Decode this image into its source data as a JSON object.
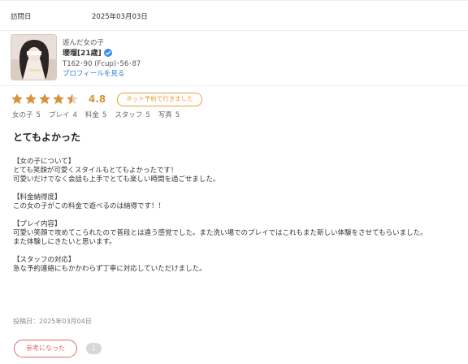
{
  "visit": {
    "label": "訪問日",
    "date": "2025年03月03日"
  },
  "profile": {
    "caption": "遊んだ女の子",
    "name": "瓔瑠[21歳]",
    "spec": "T162･90 (Fcup)･56･87",
    "link": "プロフィールを見る"
  },
  "rating": {
    "stars": 4.5,
    "score": "4.8",
    "badge": "ネット予約で行きました",
    "sub": [
      {
        "label": "女の子",
        "value": "5"
      },
      {
        "label": "プレイ",
        "value": "4"
      },
      {
        "label": "料金",
        "value": "5"
      },
      {
        "label": "スタッフ",
        "value": "5"
      },
      {
        "label": "写真",
        "value": "5"
      }
    ]
  },
  "review": {
    "title": "とてもよかった",
    "lines": [
      "【女の子について】",
      "とても笑顔が可愛くスタイルもとてもよかったです！",
      "可愛いだけでなく会話も上手でとても楽しい時間を過ごせました。",
      "",
      "【料金納得度】",
      "この女の子がこの料金で遊べるのは納得です！！",
      "",
      "【プレイ内容】",
      "可愛い笑顔で攻めてこられたので普段とは違う感覚でした。また洗い場でのプレイではこれもまた新しい体験をさせてもらいました。",
      "また体験しにきたいと思います。",
      "",
      "【スタッフの対応】",
      "急な予約連絡にもかかわらず丁寧に対応していただけました。"
    ],
    "posted": "投稿日：2025年03月04日"
  },
  "helpful": {
    "label": "参考になった",
    "count": "1"
  },
  "colors": {
    "star": "#d8933a",
    "badge": "#e69b2f",
    "helpful": "#e06a6a",
    "link": "#2a7fd4"
  }
}
